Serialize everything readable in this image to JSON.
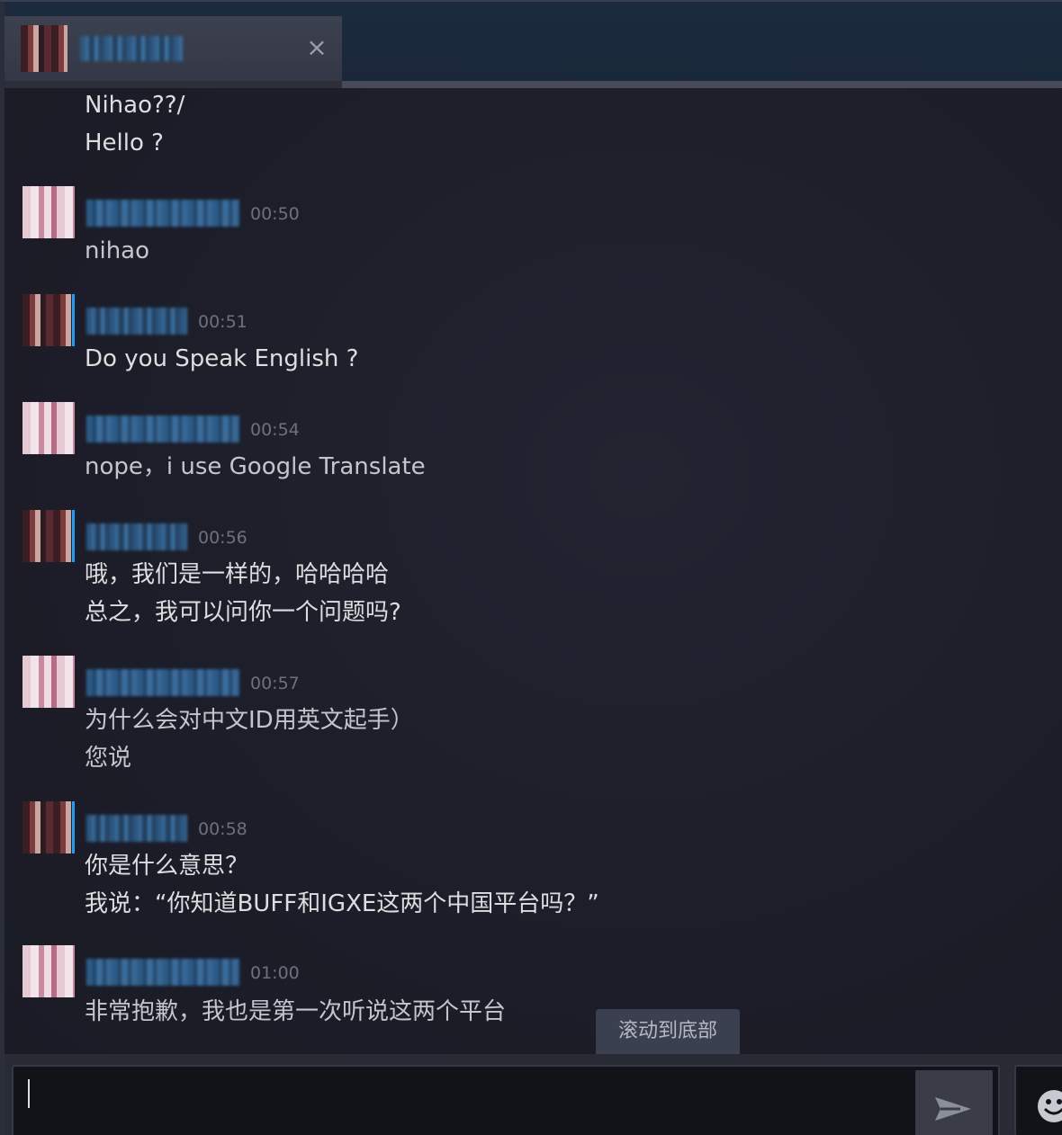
{
  "tabs": [
    {
      "label": "",
      "close_icon": "close-icon"
    }
  ],
  "messages": [
    {
      "sender": "",
      "time": "",
      "lines": [
        "Nihao??/",
        "Hello ?"
      ]
    },
    {
      "sender": "",
      "time": "00:50",
      "lines": [
        "nihao"
      ]
    },
    {
      "sender": "",
      "time": "00:51",
      "lines": [
        "Do you Speak English ?"
      ]
    },
    {
      "sender": "",
      "time": "00:54",
      "lines": [
        "nope，i use Google Translate"
      ]
    },
    {
      "sender": "",
      "time": "00:56",
      "lines": [
        "哦，我们是一样的，哈哈哈哈",
        "总之，我可以问你一个问题吗?"
      ]
    },
    {
      "sender": "",
      "time": "00:57",
      "lines": [
        "为什么会对中文ID用英文起手）",
        "您说"
      ]
    },
    {
      "sender": "",
      "time": "00:58",
      "lines": [
        "你是什么意思？",
        "我说：“你知道BUFF和IGXE这两个中国平台吗？”"
      ]
    },
    {
      "sender": "",
      "time": "01:00",
      "lines": [
        "非常抱歉，我也是第一次听说这两个平台"
      ]
    }
  ],
  "scroll_to_bottom_label": "滚动到底部",
  "composer": {
    "value": "",
    "send_icon": "send-arrow-icon",
    "emoji_icon": "emoji-icon"
  },
  "colors": {
    "background": "#1c1d28",
    "accent": "#1a9fff",
    "text": "#dcdedf",
    "timestamp": "#6c7180"
  }
}
